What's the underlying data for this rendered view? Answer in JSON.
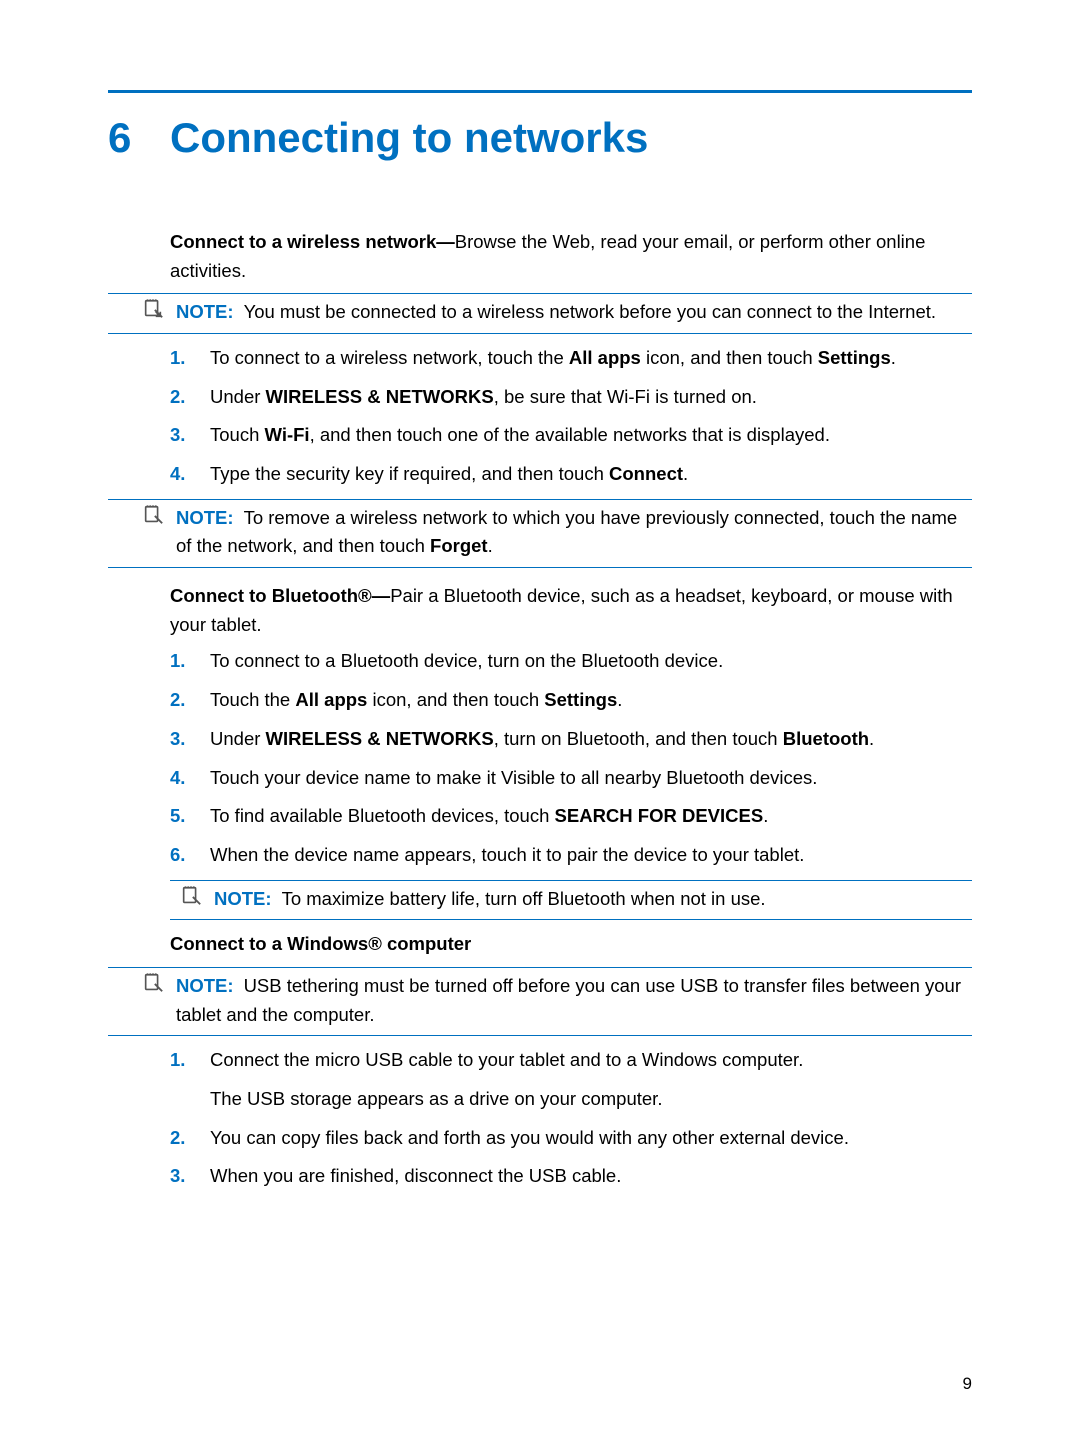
{
  "chapter": {
    "number": "6",
    "title": "Connecting to networks"
  },
  "intro_wifi": {
    "bold": "Connect to a wireless network—",
    "rest": "Browse the Web, read your email, or perform other online activities."
  },
  "note1": {
    "label": "NOTE:",
    "text": "You must be connected to a wireless network before you can connect to the Internet."
  },
  "wifi_steps": [
    {
      "n": "1.",
      "pre": "To connect to a wireless network, touch the ",
      "b1": "All apps",
      "mid": " icon, and then touch ",
      "b2": "Settings",
      "post": "."
    },
    {
      "n": "2.",
      "pre": "Under ",
      "b1": "WIRELESS & NETWORKS",
      "post": ", be sure that Wi-Fi is turned on."
    },
    {
      "n": "3.",
      "pre": "Touch ",
      "b1": "Wi-Fi",
      "post": ", and then touch one of the available networks that is displayed."
    },
    {
      "n": "4.",
      "pre": "Type the security key if required, and then touch ",
      "b1": "Connect",
      "post": "."
    }
  ],
  "note2": {
    "label": "NOTE:",
    "pre": "To remove a wireless network to which you have previously connected, touch the name of the network, and then touch ",
    "b1": "Forget",
    "post": "."
  },
  "intro_bt": {
    "bold": "Connect to Bluetooth®—",
    "rest": "Pair a Bluetooth device, such as a headset, keyboard, or mouse with your tablet."
  },
  "bt_steps": [
    {
      "n": "1.",
      "pre": "To connect to a Bluetooth device, turn on the Bluetooth device."
    },
    {
      "n": "2.",
      "pre": "Touch the ",
      "b1": "All apps",
      "mid": " icon, and then touch ",
      "b2": "Settings",
      "post": "."
    },
    {
      "n": "3.",
      "pre": "Under ",
      "b1": "WIRELESS & NETWORKS",
      "mid": ", turn on Bluetooth, and then touch ",
      "b2": "Bluetooth",
      "post": "."
    },
    {
      "n": "4.",
      "pre": "Touch your device name to make it Visible to all nearby Bluetooth devices."
    },
    {
      "n": "5.",
      "pre": "To find available Bluetooth devices, touch ",
      "b1": "SEARCH FOR DEVICES",
      "post": "."
    },
    {
      "n": "6.",
      "pre": "When the device name appears, touch it to pair the device to your tablet."
    }
  ],
  "note3": {
    "label": "NOTE:",
    "text": "To maximize battery life, turn off Bluetooth when not in use."
  },
  "subhead_win": "Connect to a Windows® computer",
  "note4": {
    "label": "NOTE:",
    "text": "USB tethering must be turned off before you can use USB to transfer files between your tablet and the computer."
  },
  "win_steps": [
    {
      "n": "1.",
      "pre": "Connect the micro USB cable to your tablet and to a Windows computer.",
      "sub": "The USB storage appears as a drive on your computer."
    },
    {
      "n": "2.",
      "pre": "You can copy files back and forth as you would with any other external device."
    },
    {
      "n": "3.",
      "pre": "When you are finished, disconnect the USB cable."
    }
  ],
  "page_number": "9"
}
